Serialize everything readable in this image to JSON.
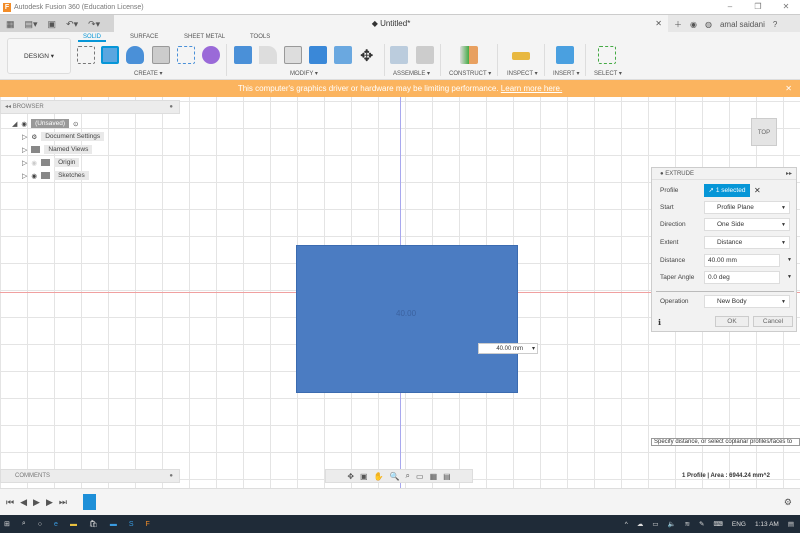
{
  "window": {
    "title": "Autodesk Fusion 360 (Education License)",
    "doc_title": "Untitled*",
    "user": "amal saidani"
  },
  "ribbon": {
    "workspace": "DESIGN ▾",
    "tabs": [
      "SOLID",
      "SURFACE",
      "SHEET METAL",
      "TOOLS"
    ],
    "active_tab": "SOLID",
    "groups": [
      "CREATE ▾",
      "MODIFY ▾",
      "ASSEMBLE ▾",
      "CONSTRUCT ▾",
      "INSPECT ▾",
      "INSERT ▾",
      "SELECT ▾"
    ]
  },
  "banner": {
    "text": "This computer's graphics driver or hardware may be limiting performance.",
    "link": "Learn more here.",
    "color": "#fbb45f"
  },
  "browser": {
    "title": "BROWSER",
    "root": "(Unsaved)",
    "items": [
      "Document Settings",
      "Named Views",
      "Origin",
      "Sketches"
    ]
  },
  "viewcube": {
    "face": "TOP"
  },
  "canvas": {
    "profile_label": "40.00",
    "dimension_input": "40.00 mm",
    "profile_color": "#4b7cc2"
  },
  "extrude": {
    "title": "EXTRUDE",
    "fields": [
      {
        "label": "Profile",
        "value": "1 selected"
      },
      {
        "label": "Start",
        "value": "Profile Plane"
      },
      {
        "label": "Direction",
        "value": "One Side"
      },
      {
        "label": "Extent",
        "value": "Distance"
      },
      {
        "label": "Distance",
        "value": "40.00 mm"
      },
      {
        "label": "Taper Angle",
        "value": "0.0 deg"
      },
      {
        "label": "Operation",
        "value": "New Body"
      }
    ],
    "ok": "OK",
    "cancel": "Cancel"
  },
  "hint": "Specify distance, or select coplanar profiles/faces to",
  "comments": "COMMENTS",
  "status": "1 Profile | Area : 6944.24 mm^2",
  "taskbar": {
    "lang": "ENG",
    "time": "1:13 AM"
  }
}
